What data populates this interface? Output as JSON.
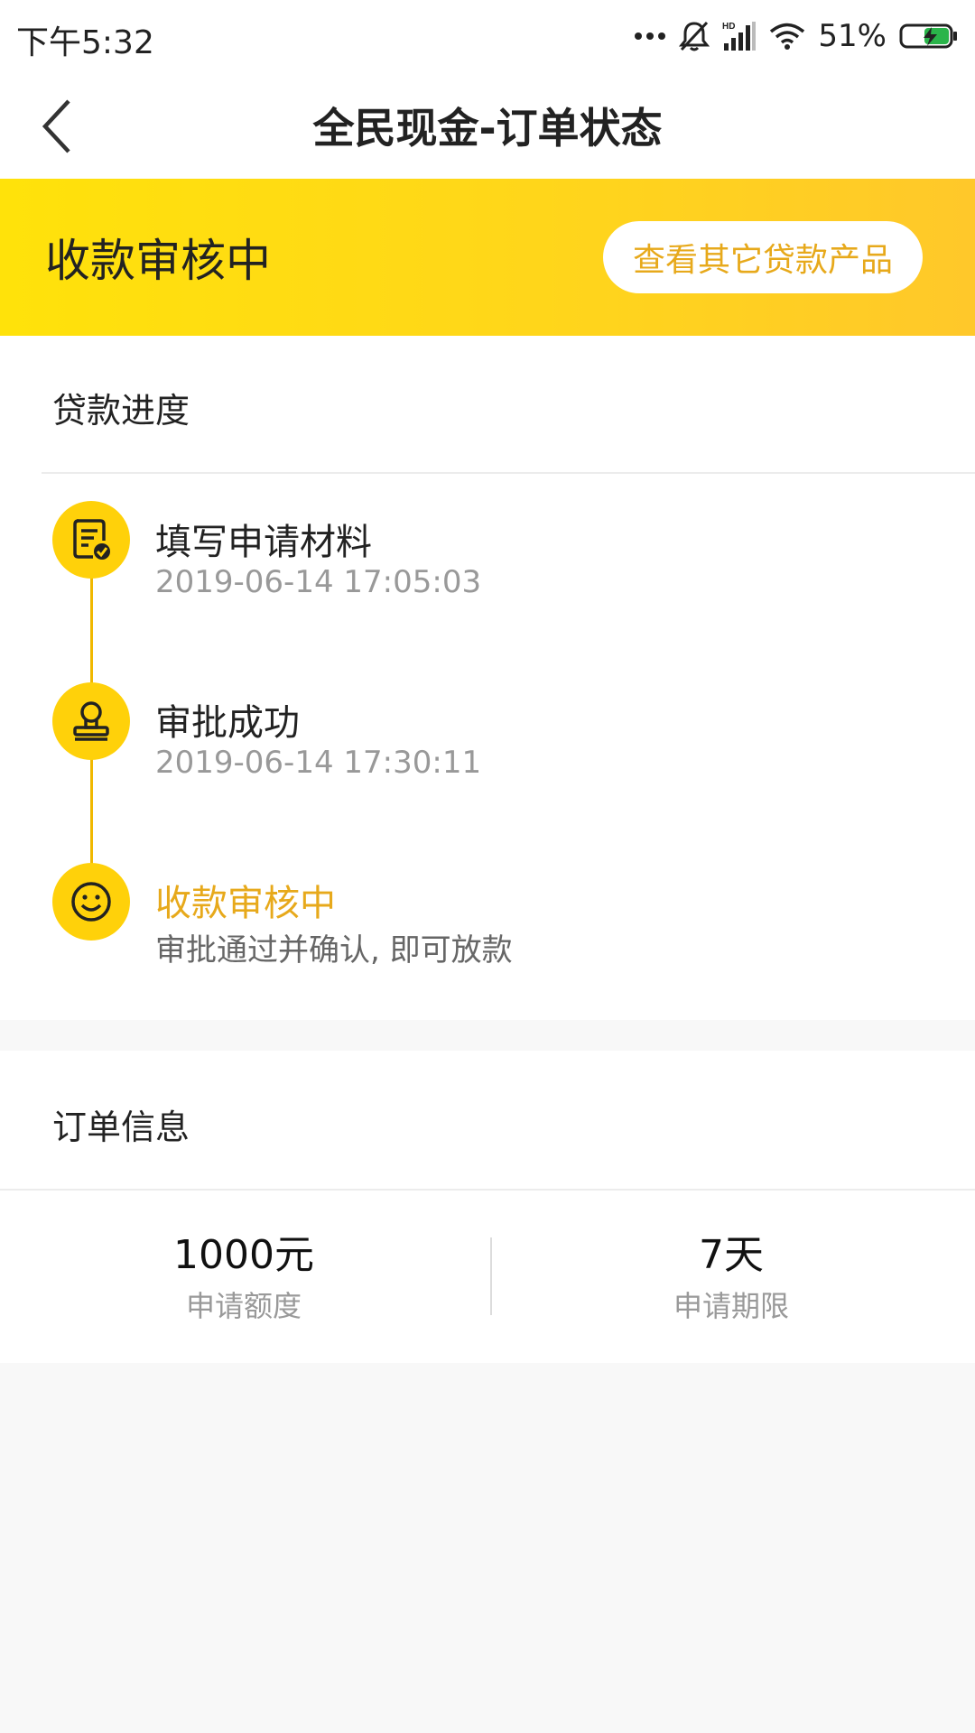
{
  "status_bar": {
    "time": "下午5:32",
    "battery": "51%",
    "icons": [
      "more-dots-icon",
      "bell-muted-icon",
      "hd-signal-icon",
      "wifi-icon",
      "battery-charging-icon"
    ]
  },
  "header": {
    "title": "全民现金-订单状态",
    "back_icon": "chevron-left-icon"
  },
  "banner": {
    "status": "收款审核中",
    "button_label": "查看其它贷款产品",
    "accent_color": "#ffd61a",
    "button_text_color": "#e7a91b"
  },
  "progress": {
    "title": "贷款进度",
    "steps": [
      {
        "title": "填写申请材料",
        "subtitle": "2019-06-14 17:05:03",
        "icon": "document-check-icon"
      },
      {
        "title": "审批成功",
        "subtitle": "2019-06-14 17:30:11",
        "icon": "stamp-icon"
      },
      {
        "title": "收款审核中",
        "subtitle": "审批通过并确认, 即可放款",
        "icon": "smile-icon"
      }
    ]
  },
  "order": {
    "title": "订单信息",
    "items": [
      {
        "value": "1000元",
        "label": "申请额度"
      },
      {
        "value": "7天",
        "label": "申请期限"
      }
    ]
  }
}
